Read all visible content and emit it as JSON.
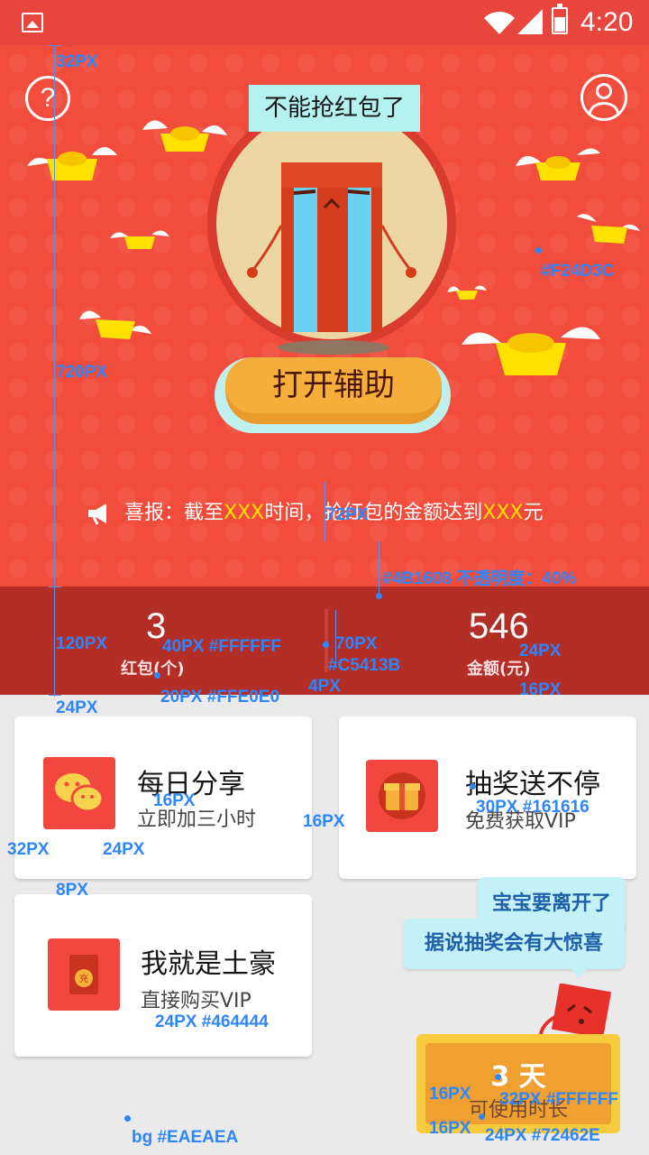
{
  "status_bar": {
    "time": "4:20"
  },
  "hero": {
    "title_tag": "不能抢红包了",
    "assist_button": "打开辅助",
    "news": {
      "prefix": "喜报：截至",
      "x1": "XXX",
      "mid": "时间，抢红包的金额达到",
      "x2": "XXX",
      "suffix": "元"
    }
  },
  "stats": {
    "count": {
      "value": "3",
      "label": "红包(个)"
    },
    "amount": {
      "value": "546",
      "label": "金额(元)"
    }
  },
  "cards": [
    {
      "title": "每日分享",
      "subtitle": "立即加三小时",
      "icon": "wechat-icon"
    },
    {
      "title": "抽奖送不停",
      "subtitle": "免费获取VIP",
      "icon": "gift-box-icon"
    },
    {
      "title": "我就是土豪",
      "subtitle": "直接购买VIP",
      "icon": "charge-envelope-icon"
    }
  ],
  "tooltip": {
    "line1": "宝宝要离开了",
    "line2": "据说抽奖会有大惊喜"
  },
  "duration": {
    "value": "3 天",
    "label": "可使用时长"
  },
  "annotations": {
    "a32": "32PX",
    "hero_color": "#F24D3C",
    "a720": "720PX",
    "a72": "72PX",
    "overlay": "#4B1608 不透明度：40%",
    "a120": "120PX",
    "num_spec": "40PX #FFFFFF",
    "label_spec": "20PX #FFE0E0",
    "a70": "70PX",
    "divider_color": "#C5413B",
    "a4": "4PX",
    "a24": "24PX",
    "a16": "16PX",
    "card_a24_top": "24PX",
    "card_16": "16PX",
    "card_32": "32PX",
    "card_24": "24PX",
    "card_16_gap": "16PX",
    "title_spec": "30PX #161616",
    "card_8": "8PX",
    "sub_spec": "24PX #464444",
    "days_16a": "16PX",
    "days_spec": "32PX #FFFFFF",
    "days_16b": "16PX",
    "days_label_spec": "24PX #72462E",
    "bg": "bg #EAEAEA"
  },
  "colors": {
    "hero_bg": "#F24D3C",
    "stats_overlay": "#4B1608",
    "divider": "#C5413B",
    "number": "#FFFFFF",
    "label": "#FFE0E0",
    "title": "#161616",
    "subtitle": "#464444",
    "days_label": "#72462E",
    "page_bg": "#EAEAEA"
  }
}
